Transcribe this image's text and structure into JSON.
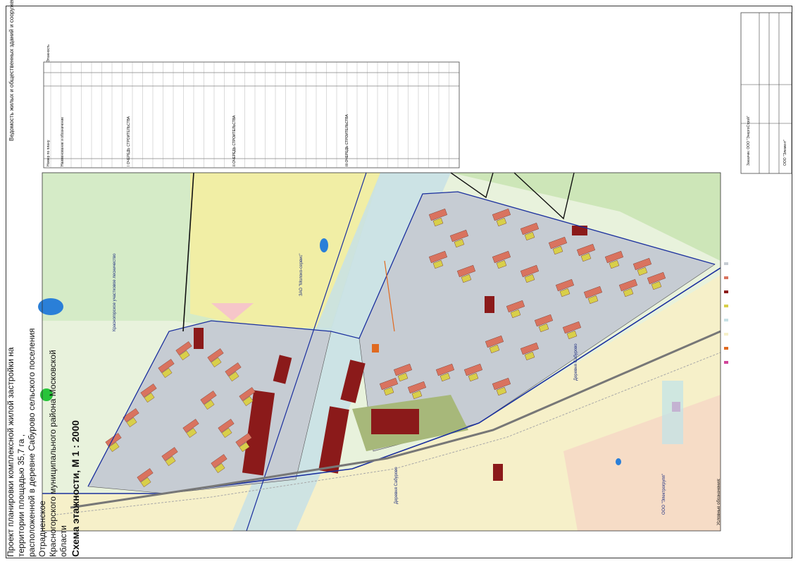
{
  "sheet": {
    "title_line1": "Проект планировки комплексной жилой застройки на территории площадью 35,7 га ,",
    "title_line2": "расположенной в деревне Сабурово сельского поселения Отрадненское",
    "title_line3": "Красногорского муниципального района Московской области",
    "scheme_title": "Схема этажности, М 1 : 2000",
    "table_title": "Ведомость жилых и общественных зданий и сооружений"
  },
  "table": {
    "headers": [
      "Номер по плану",
      "Наименование и обозначение",
      "Этажность"
    ],
    "sections": [
      {
        "label": "I ОЧЕРЕДЬ СТРОИТЕЛЬСТВА"
      },
      {
        "label": "II ОЧЕРЕДЬ СТРОИТЕЛЬСТВА"
      },
      {
        "label": "III ОЧЕРЕДЬ СТРОИТЕЛЬСТВА"
      }
    ]
  },
  "map_labels": {
    "kr_forest": "Красногорское участковое лесничество",
    "zao": "ЗАО \"Молоко-сервис\"",
    "derevnya1": "Деревня Сабурово",
    "derevnya2": "Деревня Сабурово",
    "kr_forest2": "Красногорское участковое лесничество",
    "ooo": "ООО \"Электрогрупп\""
  },
  "legend": {
    "title": "Условные обозначения:"
  },
  "stamp": {
    "org": "ООО \"Элемент\"",
    "client": "Заказчик: ООО \"ЭнергоСтрой\""
  },
  "colors": {
    "forest": "#cfe8c0",
    "field": "#f3f0a8",
    "residential_zone": "#c9cfd6",
    "building": "#d9735f",
    "public_building": "#8b1a1a",
    "courtyard": "#d8cf4a",
    "power_corridor": "#bcdbe0",
    "village": "#f7f1c8",
    "boundary": "#1a2f9e",
    "water": "#2a7fd8"
  }
}
